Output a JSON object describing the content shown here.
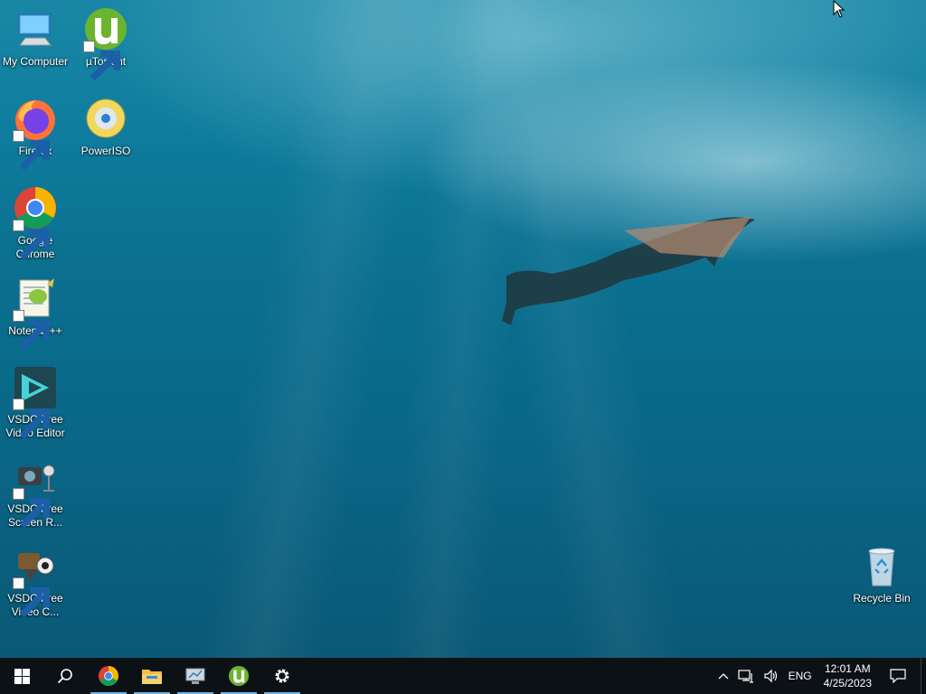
{
  "desktop": {
    "icons": [
      {
        "label": "My Computer"
      },
      {
        "label": "µTorrent"
      },
      {
        "label": "Firefox"
      },
      {
        "label": "PowerISO"
      },
      {
        "label": "Google Chrome"
      },
      {
        "label": "Notepad++"
      },
      {
        "label": "VSDC Free Video Editor"
      },
      {
        "label": "VSDC Free Screen R..."
      },
      {
        "label": "VSDC Free Video C..."
      },
      {
        "label": "Recycle Bin"
      }
    ]
  },
  "taskbar": {
    "pinned": [
      "start-button",
      "search",
      "google-chrome",
      "file-explorer",
      "network-app",
      "utorrent",
      "settings"
    ],
    "tray": {
      "language": "ENG",
      "time": "12:01 AM",
      "date": "4/25/2023"
    }
  },
  "colors": {
    "taskbar_bg": "#0c1116",
    "accent": "#6fb3e8",
    "desktop_water": "#0b6f8f"
  }
}
